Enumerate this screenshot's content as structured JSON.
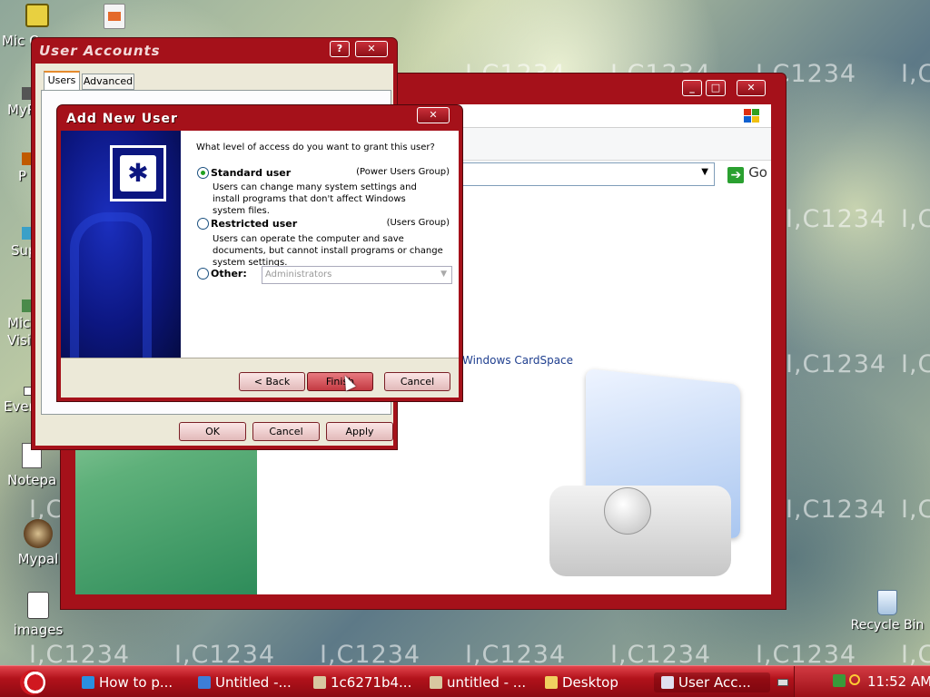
{
  "watermark_text": "I,C1234",
  "desktop": {
    "icons": [
      {
        "label": "Mic Ou",
        "icon": "outlook-icon"
      },
      {
        "label": "MyP",
        "icon": "folder-icon"
      },
      {
        "label": "P",
        "icon": "shortcut-icon"
      },
      {
        "label": "Sup",
        "icon": "shortcut-icon"
      },
      {
        "label": "Micr Visi",
        "icon": "visio-icon"
      },
      {
        "label": "Ever",
        "icon": "shortcut-icon"
      },
      {
        "label": "Notepa",
        "icon": "notepad-icon"
      },
      {
        "label": "Mypal",
        "icon": "mypal-icon"
      },
      {
        "label": "images",
        "icon": "image-file-icon"
      },
      {
        "label": "Recycle Bin",
        "icon": "recycle-bin-icon"
      }
    ]
  },
  "bg_window": {
    "go_label": "Go",
    "cardspace_link": "Windows CardSpace"
  },
  "user_accounts": {
    "title": "User Accounts",
    "tabs": [
      "Users",
      "Advanced"
    ],
    "ok_label": "OK",
    "cancel_label": "Cancel",
    "apply_label": "Apply"
  },
  "add_new_user": {
    "title": "Add New User",
    "question": "What level of access do you want to grant this user?",
    "options": [
      {
        "label": "Standard user",
        "group": "(Power Users Group)",
        "desc": "Users can change many system settings and install programs that don't affect Windows system files.",
        "selected": true
      },
      {
        "label": "Restricted user",
        "group": "(Users Group)",
        "desc": "Users can operate the computer and save documents, but cannot install programs or change system settings.",
        "selected": false
      },
      {
        "label": "Other:",
        "group": "",
        "desc": "",
        "selected": false
      }
    ],
    "other_select_value": "Administrators",
    "back_label": "< Back",
    "finish_label": "Finish",
    "cancel_label": "Cancel"
  },
  "taskbar": {
    "items": [
      {
        "label": "How to p...",
        "icon": "ie-icon"
      },
      {
        "label": "Untitled -...",
        "icon": "document-icon"
      },
      {
        "label": "1c6271b4...",
        "icon": "paint-icon"
      },
      {
        "label": "untitled - ...",
        "icon": "paint-icon"
      },
      {
        "label": "Desktop",
        "icon": "folder-icon"
      },
      {
        "label": "User Acc...",
        "icon": "user-accounts-icon"
      }
    ],
    "clock": "11:52 AM"
  },
  "colors": {
    "window_frame": "#a5111a",
    "taskbar": "#b2121b",
    "dialog_face": "#ece9d8"
  }
}
